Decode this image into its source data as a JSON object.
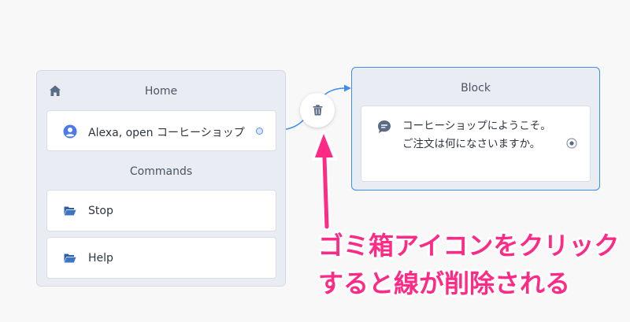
{
  "home_block": {
    "title": "Home",
    "intent_label": "Alexa, open コーヒーショップ",
    "commands_title": "Commands",
    "commands": [
      "Stop",
      "Help"
    ]
  },
  "block_node": {
    "title": "Block",
    "speech": "コーヒーショップにようこそ。ご注文は何になさいますか。"
  },
  "annotation": {
    "line1": "ゴミ箱アイコンをクリック",
    "line2": "すると線が削除される"
  },
  "colors": {
    "accent": "#3d8ef0",
    "annotation": "#ff2a86",
    "icon": "#5a6b85",
    "user_icon": "#4a7be8"
  },
  "icons": {
    "home": "home-icon",
    "user": "user-circle-icon",
    "folder": "folder-open-icon",
    "speech": "speech-bubble-icon",
    "radio": "radio-icon",
    "trash": "trash-icon"
  }
}
